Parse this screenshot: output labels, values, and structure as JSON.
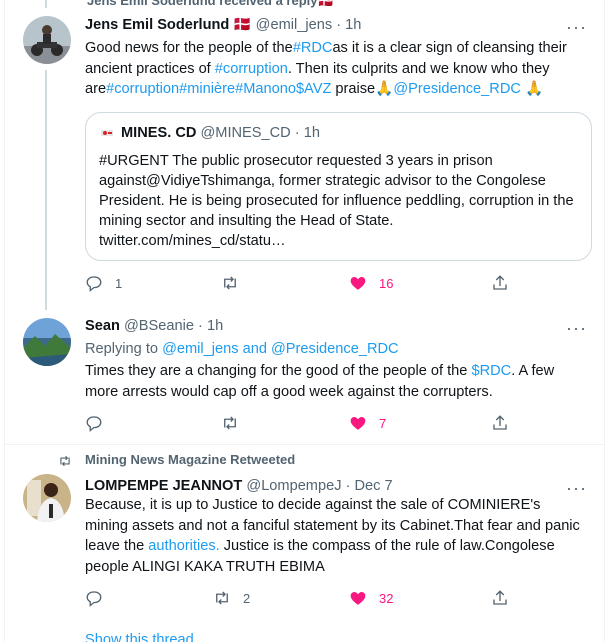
{
  "context_top": {
    "text": "Jens Emil Soderlund  received a reply",
    "flag": "🇩🇰"
  },
  "tweets": [
    {
      "name": "Jens Emil Soderlund",
      "flag": "🇩🇰",
      "handle": "@emil_jens",
      "time": "1h",
      "text_parts": [
        {
          "t": "Good news for the people of the",
          "link": false
        },
        {
          "t": "#RDC",
          "link": true
        },
        {
          "t": "as it is a clear sign of cleansing their ancient practices of ",
          "link": false
        },
        {
          "t": "#corruption",
          "link": true
        },
        {
          "t": ". Then its culprits and we know who they are",
          "link": false
        },
        {
          "t": "#corruption",
          "link": true
        },
        {
          "t": "#minière",
          "link": true
        },
        {
          "t": "#Manono",
          "link": true
        },
        {
          "t": "$AVZ",
          "link": true
        },
        {
          "t": " praise🙏",
          "link": false
        },
        {
          "t": "@Presidence_RDC",
          "link": true
        },
        {
          "t": " 🙏",
          "link": false
        }
      ],
      "quote": {
        "name": "MINES. CD",
        "handle": "@MINES_CD",
        "time": "1h",
        "text": "#URGENT The public prosecutor requested 3 years in prison against@VidiyeTshimanga, former strategic advisor to the Congolese President. He is being prosecuted for influence peddling, corruption in the mining sector and insulting the Head of State. twitter.com/mines_cd/statu…"
      },
      "actions": {
        "replies": "1",
        "retweets": "",
        "likes": "16"
      }
    },
    {
      "name": "Sean",
      "handle": "@BSeanie",
      "time": "1h",
      "replying_prefix": "Replying to ",
      "replying_to": "@emil_jens and @Presidence_RDC",
      "text_parts": [
        {
          "t": "Times they are a changing for the good of the people of the ",
          "link": false
        },
        {
          "t": "$RDC",
          "link": true
        },
        {
          "t": ". A few more arrests would cap off a good week against the corrupters.",
          "link": false
        }
      ],
      "actions": {
        "replies": "",
        "retweets": "",
        "likes": "7"
      }
    },
    {
      "retweeted_by": "Mining News Magazine Retweeted",
      "name": "LOMPEMPE JEANNOT",
      "handle": "@LompempeJ",
      "time": "Dec 7",
      "text_parts": [
        {
          "t": "Because, it is up to Justice to decide against the sale of COMINIERE's mining assets and not a fanciful statement by its Cabinet.That fear and panic leave the ",
          "link": false
        },
        {
          "t": "authorities.",
          "link": true
        },
        {
          "t": " Justice is the compass of the rule of law.Congolese people ALINGI KAKA TRUTH EBIMA",
          "link": false
        }
      ],
      "actions": {
        "replies": "",
        "retweets": "2",
        "likes": "32"
      }
    }
  ],
  "show_thread": "Show this thread",
  "icons": {
    "reply": "reply-icon",
    "retweet": "retweet-icon",
    "like": "heart-icon",
    "share": "share-icon",
    "more": "more-icon"
  },
  "colors": {
    "link": "#1d9bf0",
    "like": "#f91880",
    "muted": "#536471",
    "text": "#0f1419"
  }
}
